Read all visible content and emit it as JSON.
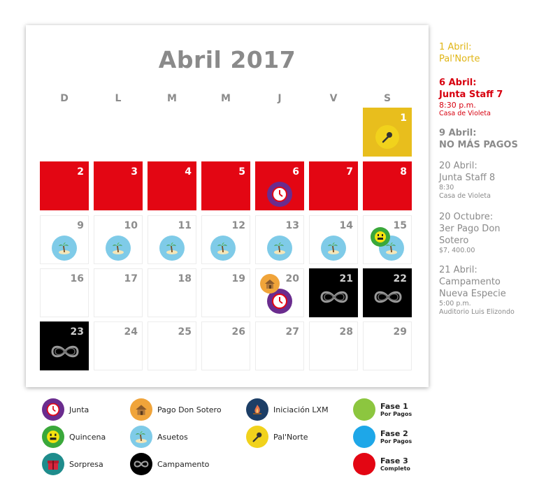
{
  "calendar": {
    "title": "Abril 2017",
    "weekdays": [
      "D",
      "L",
      "M",
      "M",
      "J",
      "V",
      "S"
    ],
    "days": {
      "d1": "1",
      "d2": "2",
      "d3": "3",
      "d4": "4",
      "d5": "5",
      "d6": "6",
      "d7": "7",
      "d8": "8",
      "d9": "9",
      "d10": "10",
      "d11": "11",
      "d12": "12",
      "d13": "13",
      "d14": "14",
      "d15": "15",
      "d16": "16",
      "d17": "17",
      "d18": "18",
      "d19": "19",
      "d20": "20",
      "d21": "21",
      "d22": "22",
      "d23": "23",
      "d24": "24",
      "d25": "25",
      "d26": "26",
      "d27": "27",
      "d28": "28",
      "d29": "29"
    }
  },
  "sidebar": {
    "e1": {
      "title": "1 Abril:\nPal'Norte"
    },
    "e2": {
      "title": "6 Abril:\nJunta Staff 7",
      "time": "8:30 p.m.",
      "place": "Casa de Violeta"
    },
    "e3": {
      "title": "9 Abril:\nNO MÁS PAGOS"
    },
    "e4": {
      "title": "20 Abril:\nJunta Staff 8",
      "time": "8:30",
      "place": "Casa de Violeta"
    },
    "e5": {
      "title": "20 Octubre:\n3er Pago Don\nSotero",
      "amount": "$7, 400.00"
    },
    "e6": {
      "title": "21 Abril:\nCampamento\nNueva Especie",
      "time": "5:00 p.m.",
      "place": "Auditorio Luis Elizondo"
    }
  },
  "legend": {
    "junta": "Junta",
    "quincena": "Quincena",
    "sorpresa": "Sorpresa",
    "pago": "Pago Don Sotero",
    "asuetos": "Asuetos",
    "campamento": "Campamento",
    "iniciacion": "Iniciación LXM",
    "palnorte": "Pal'Norte",
    "fase1": {
      "name": "Fase 1",
      "sub": "Por Pagos"
    },
    "fase2": {
      "name": "Fase 2",
      "sub": "Por Pagos"
    },
    "fase3": {
      "name": "Fase 3",
      "sub": "Completo"
    }
  },
  "colors": {
    "red": "#e30613",
    "gold": "#e8be1d",
    "black": "#000000",
    "junta": "#6a2c8e",
    "quincena": "#3aa83a",
    "sorpresa": "#1f8c8c",
    "pago": "#f0a43a",
    "asuetos": "#7fcbe8",
    "iniciacion": "#1c3e66",
    "palnorte": "#f1d21c",
    "fase1": "#8cc63f",
    "fase2": "#1ea7e8",
    "fase3": "#e30613"
  }
}
